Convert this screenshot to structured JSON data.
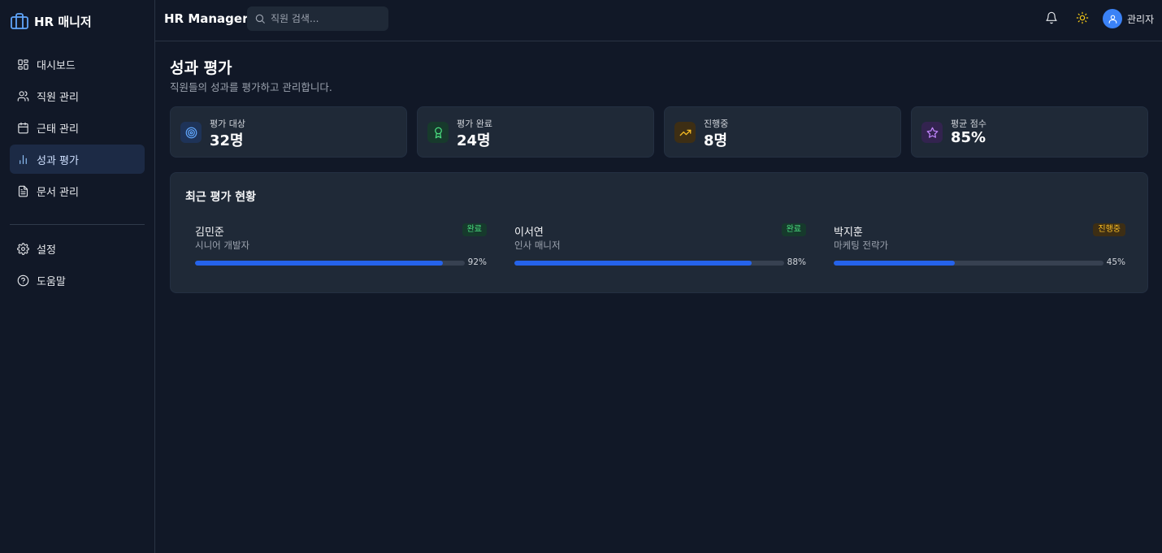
{
  "brand": {
    "name": "HR 매니저"
  },
  "nav": {
    "items": [
      {
        "label": "대시보드",
        "icon": "dashboard-icon"
      },
      {
        "label": "직원 관리",
        "icon": "users-icon"
      },
      {
        "label": "근태 관리",
        "icon": "calendar-icon"
      },
      {
        "label": "성과 평가",
        "icon": "bar-chart-icon",
        "active": true
      },
      {
        "label": "문서 관리",
        "icon": "document-icon"
      }
    ],
    "secondary": [
      {
        "label": "설정",
        "icon": "gear-icon"
      },
      {
        "label": "도움말",
        "icon": "help-icon"
      }
    ]
  },
  "header": {
    "title": "HR Manager",
    "search_placeholder": "직원 검색...",
    "user_name": "관리자"
  },
  "page": {
    "title": "성과 평가",
    "subtitle": "직원들의 성과를 평가하고 관리합니다."
  },
  "stats": [
    {
      "label": "평가 대상",
      "value": "32명",
      "icon": "target-icon",
      "color": "#60a5fa"
    },
    {
      "label": "평가 완료",
      "value": "24명",
      "icon": "award-icon",
      "color": "#4ade80"
    },
    {
      "label": "진행중",
      "value": "8명",
      "icon": "trending-up-icon",
      "color": "#fbbf24"
    },
    {
      "label": "평균 점수",
      "value": "85%",
      "icon": "star-icon",
      "color": "#c084fc"
    }
  ],
  "recent": {
    "title": "최근 평가 현황",
    "items": [
      {
        "name": "김민준",
        "role": "시니어 개발자",
        "status": "완료",
        "progress": 92,
        "progress_label": "92%"
      },
      {
        "name": "이서연",
        "role": "인사 매니저",
        "status": "완료",
        "progress": 88,
        "progress_label": "88%"
      },
      {
        "name": "박지훈",
        "role": "마케팅 전략가",
        "status": "진행중",
        "progress": 45,
        "progress_label": "45%"
      }
    ]
  },
  "colors": {
    "background": "#111827",
    "card": "#1f2937",
    "accent": "#2563eb",
    "success": "#4ade80",
    "warning": "#fbbf24"
  }
}
